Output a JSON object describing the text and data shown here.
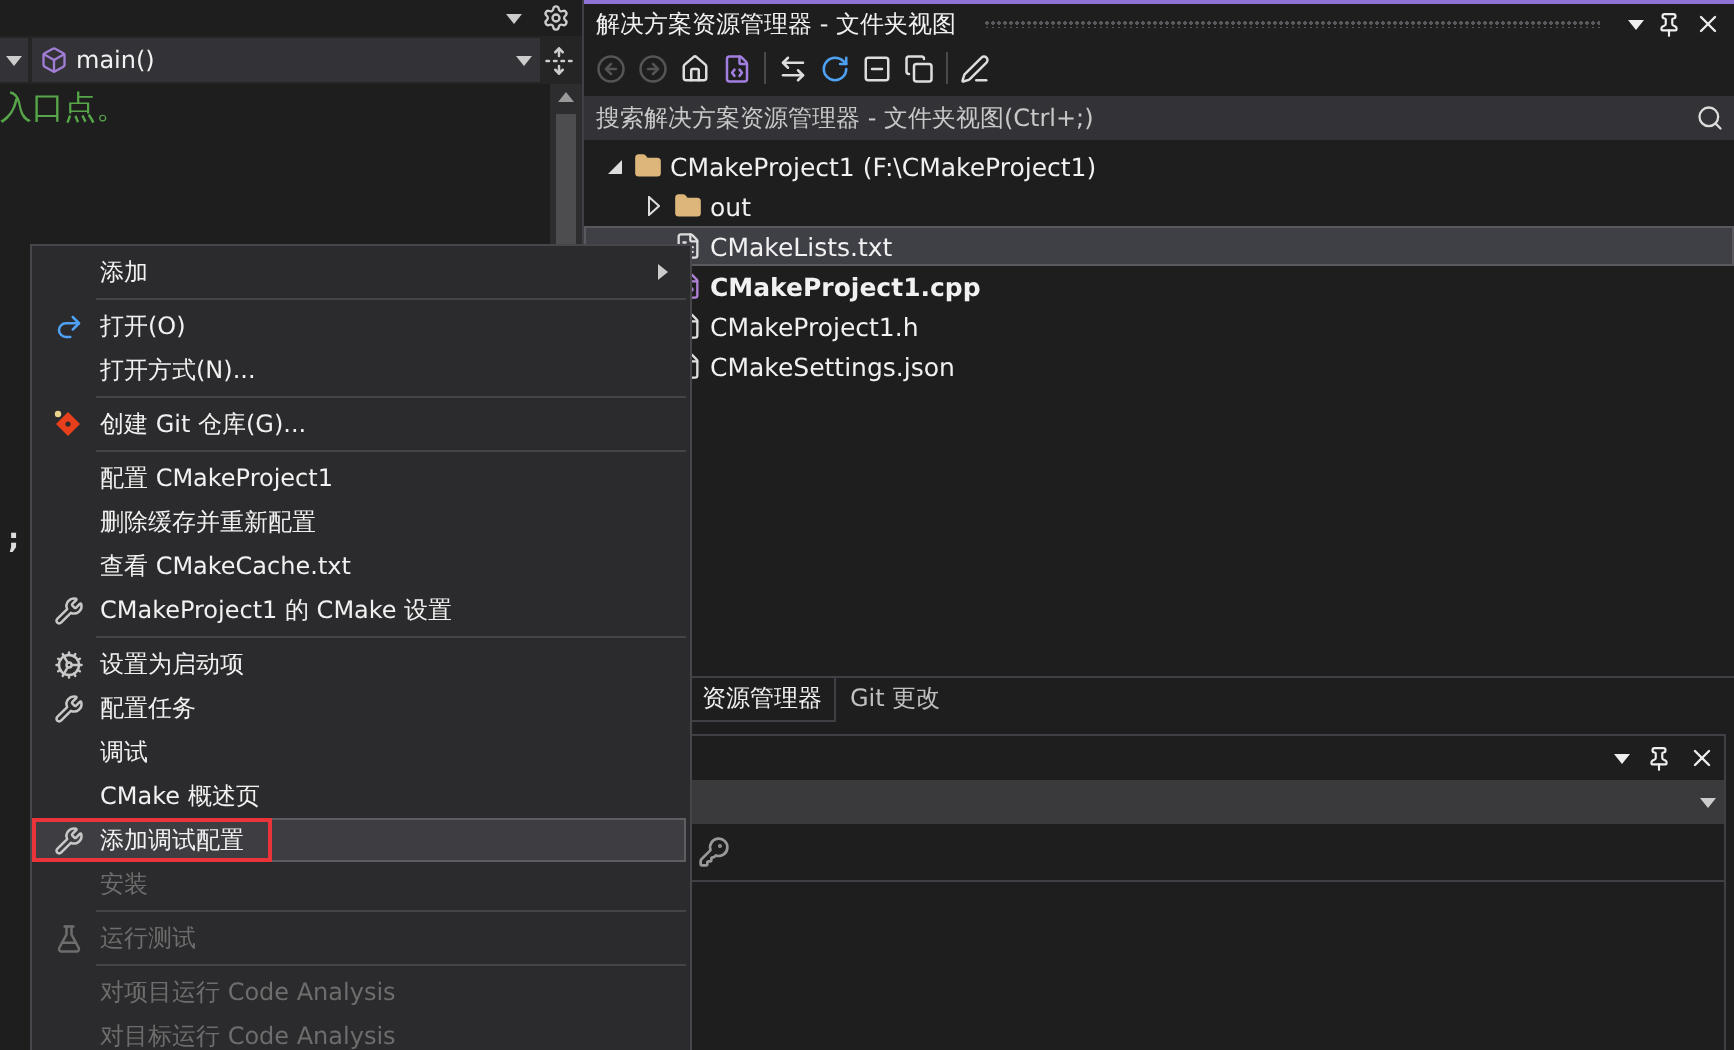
{
  "editor": {
    "function_dropdown": "main()",
    "code_comment": "入口点。",
    "lower_fragment": ";"
  },
  "solution_explorer": {
    "title": "解决方案资源管理器 - 文件夹视图",
    "search": {
      "placeholder": "搜索解决方案资源管理器 - 文件夹视图(Ctrl+;)"
    },
    "tree": [
      {
        "label": "CMakeProject1 (F:\\CMakeProject1)",
        "kind": "folder",
        "expanded": true,
        "selected": false,
        "bold": false,
        "children": [
          {
            "label": "out",
            "kind": "folder",
            "expanded": false,
            "selected": false,
            "bold": false
          },
          {
            "label": "CMakeLists.txt",
            "kind": "text-file",
            "selected": true,
            "bold": false
          },
          {
            "label": "CMakeProject1.cpp",
            "kind": "cpp-file",
            "selected": false,
            "bold": true
          },
          {
            "label": "CMakeProject1.h",
            "kind": "header-file",
            "selected": false,
            "bold": false
          },
          {
            "label": "CMakeSettings.json",
            "kind": "json-file",
            "selected": false,
            "bold": false
          }
        ]
      }
    ],
    "tabs": [
      {
        "label": "资源管理器",
        "selected": true
      },
      {
        "label": "Git 更改",
        "selected": false
      }
    ]
  },
  "context_menu": [
    {
      "kind": "submenu",
      "label": "添加",
      "selected": false,
      "disabled": false,
      "annotated": false
    },
    {
      "kind": "separator"
    },
    {
      "kind": "open",
      "label": "打开(O)",
      "selected": false,
      "disabled": false,
      "annotated": false
    },
    {
      "kind": "plain",
      "label": "打开方式(N)...",
      "selected": false,
      "disabled": false,
      "annotated": false
    },
    {
      "kind": "separator"
    },
    {
      "kind": "git",
      "label": "创建 Git 仓库(G)...",
      "selected": false,
      "disabled": false,
      "annotated": false
    },
    {
      "kind": "separator"
    },
    {
      "kind": "plain",
      "label": "配置 CMakeProject1",
      "selected": false,
      "disabled": false,
      "annotated": false
    },
    {
      "kind": "plain",
      "label": "删除缓存并重新配置",
      "selected": false,
      "disabled": false,
      "annotated": false
    },
    {
      "kind": "plain",
      "label": "查看 CMakeCache.txt",
      "selected": false,
      "disabled": false,
      "annotated": false
    },
    {
      "kind": "wrench",
      "label": "CMakeProject1 的 CMake 设置",
      "selected": false,
      "disabled": false,
      "annotated": false
    },
    {
      "kind": "separator"
    },
    {
      "kind": "gear",
      "label": "设置为启动项",
      "selected": false,
      "disabled": false,
      "annotated": false
    },
    {
      "kind": "wrench",
      "label": "配置任务",
      "selected": false,
      "disabled": false,
      "annotated": false
    },
    {
      "kind": "plain",
      "label": "调试",
      "selected": false,
      "disabled": false,
      "annotated": false
    },
    {
      "kind": "plain",
      "label": "CMake 概述页",
      "selected": false,
      "disabled": false,
      "annotated": false
    },
    {
      "kind": "wrench",
      "label": "添加调试配置",
      "selected": true,
      "disabled": false,
      "annotated": true
    },
    {
      "kind": "plain",
      "label": "安装",
      "selected": false,
      "disabled": true,
      "annotated": false
    },
    {
      "kind": "separator"
    },
    {
      "kind": "flask",
      "label": "运行测试",
      "selected": false,
      "disabled": true,
      "annotated": false
    },
    {
      "kind": "separator"
    },
    {
      "kind": "plain",
      "label": "对项目运行 Code Analysis",
      "selected": false,
      "disabled": true,
      "annotated": false
    },
    {
      "kind": "plain",
      "label": "对目标运行 Code Analysis",
      "selected": false,
      "disabled": true,
      "annotated": false
    }
  ]
}
